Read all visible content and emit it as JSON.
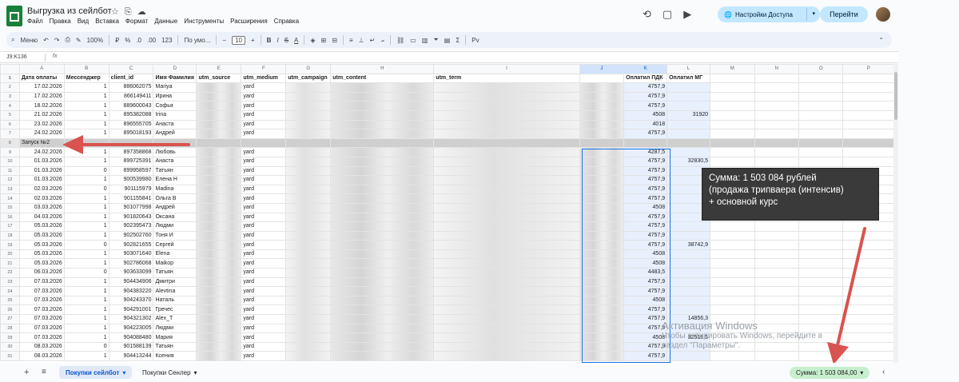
{
  "app": {
    "title": "Выгрузка из сейлбот",
    "menu": [
      "Файл",
      "Правка",
      "Вид",
      "Вставка",
      "Формат",
      "Данные",
      "Инструменты",
      "Расширения",
      "Справка"
    ],
    "access_button": "Настройки Доступа",
    "goto_button": "Перейти"
  },
  "toolbar": {
    "menus": "Меню",
    "zoom": "100%",
    "currency": "₽",
    "percent": "%",
    "decimals_down": ".0",
    "decimals_up": ".00",
    "number_format": "123",
    "font": "По умо...",
    "font_size": "10",
    "bold": "B",
    "italic": "I",
    "strike": "S",
    "text_color": "A"
  },
  "formula_bar": {
    "namebox": "J9:K136",
    "fx": "fx"
  },
  "columns": [
    "A",
    "B",
    "C",
    "D",
    "E",
    "F",
    "G",
    "H",
    "I",
    "J",
    "K",
    "L",
    "M",
    "N",
    "O",
    "P"
  ],
  "headers": [
    "Дата оплаты",
    "Мессенджер",
    "client_id",
    "Имя Фамилия",
    "utm_source",
    "utm_medium",
    "utm_campaign",
    "utm_content",
    "utm_term",
    "",
    "Оплатил ПДК",
    "Оплатил МГ"
  ],
  "rows": [
    {
      "n": "2",
      "a": "17.02.2026",
      "b": "1",
      "c": "886062075",
      "d": "Mariya",
      "f": "yard",
      "j": "4757,9",
      "k": ""
    },
    {
      "n": "3",
      "a": "17.02.2026",
      "b": "1",
      "c": "866149411",
      "d": "Ирина",
      "f": "yard",
      "j": "4757,9",
      "k": ""
    },
    {
      "n": "4",
      "a": "18.02.2026",
      "b": "1",
      "c": "889600043",
      "d": "Софья",
      "f": "yard",
      "j": "4757,9",
      "k": ""
    },
    {
      "n": "5",
      "a": "21.02.2026",
      "b": "1",
      "c": "895382088",
      "d": "Irina",
      "f": "yard",
      "j": "4508",
      "k": "31920"
    },
    {
      "n": "6",
      "a": "23.02.2026",
      "b": "1",
      "c": "896555705",
      "d": "Анаста",
      "f": "yard",
      "j": "4018",
      "k": ""
    },
    {
      "n": "7",
      "a": "24.02.2026",
      "b": "1",
      "c": "895018193",
      "d": "Андрей",
      "f": "yard",
      "j": "4757,9",
      "k": ""
    },
    {
      "n": "8",
      "launch": "Запуск №2"
    },
    {
      "n": "9",
      "a": "24.02.2026",
      "b": "1",
      "c": "897358868",
      "d": "Любовь",
      "f": "yard",
      "j": "4287,5",
      "k": ""
    },
    {
      "n": "10",
      "a": "01.03.2026",
      "b": "1",
      "c": "899725391",
      "d": "Анаста",
      "f": "yard",
      "j": "4757,9",
      "k": "32830,5"
    },
    {
      "n": "11",
      "a": "01.03.2026",
      "b": "0",
      "c": "899958597",
      "d": "Татьян",
      "f": "yard",
      "j": "4757,9",
      "k": ""
    },
    {
      "n": "12",
      "a": "01.03.2026",
      "b": "1",
      "c": "900539980",
      "d": "Елена Н",
      "f": "yard",
      "j": "4757,9",
      "k": ""
    },
    {
      "n": "13",
      "a": "02.03.2026",
      "b": "0",
      "c": "901115979",
      "d": "Madina",
      "f": "yard",
      "j": "4757,9",
      "k": ""
    },
    {
      "n": "14",
      "a": "02.03.2026",
      "b": "1",
      "c": "901155841",
      "d": "Ольга В",
      "f": "yard",
      "j": "4757,9",
      "k": ""
    },
    {
      "n": "15",
      "a": "03.03.2026",
      "b": "1",
      "c": "901077998",
      "d": "Андрей",
      "f": "yard",
      "j": "4508",
      "k": ""
    },
    {
      "n": "16",
      "a": "04.03.2026",
      "b": "1",
      "c": "901820643",
      "d": "Оксана",
      "f": "yard",
      "j": "4757,9",
      "k": ""
    },
    {
      "n": "17",
      "a": "05.03.2026",
      "b": "1",
      "c": "902395473",
      "d": "Людми",
      "f": "yard",
      "j": "4757,9",
      "k": ""
    },
    {
      "n": "18",
      "a": "05.03.2026",
      "b": "1",
      "c": "902502760",
      "d": "Тоня И",
      "f": "yard",
      "j": "4757,9",
      "k": ""
    },
    {
      "n": "19",
      "a": "05.03.2026",
      "b": "0",
      "c": "902821655",
      "d": "Сергей",
      "f": "yard",
      "j": "4757,9",
      "k": "38742,9"
    },
    {
      "n": "20",
      "a": "05.03.2026",
      "b": "1",
      "c": "903071640",
      "d": "Elena",
      "f": "yard",
      "j": "4508",
      "k": ""
    },
    {
      "n": "21",
      "a": "05.03.2026",
      "b": "1",
      "c": "902786068",
      "d": "Maikop",
      "f": "yard",
      "j": "4508",
      "k": ""
    },
    {
      "n": "22",
      "a": "06.03.2026",
      "b": "0",
      "c": "903633099",
      "d": "Татьян",
      "f": "yard",
      "j": "4483,5",
      "k": ""
    },
    {
      "n": "23",
      "a": "07.03.2026",
      "b": "1",
      "c": "904434906",
      "d": "Дмитри",
      "f": "yard",
      "j": "4757,9",
      "k": ""
    },
    {
      "n": "24",
      "a": "07.03.2026",
      "b": "1",
      "c": "904383220",
      "d": "Alevtina",
      "f": "yard",
      "j": "4757,9",
      "k": ""
    },
    {
      "n": "25",
      "a": "07.03.2026",
      "b": "1",
      "c": "904243370",
      "d": "Наталь",
      "f": "yard",
      "j": "4508",
      "k": ""
    },
    {
      "n": "26",
      "a": "07.03.2026",
      "b": "1",
      "c": "904291001",
      "d": "Гречес",
      "f": "yard",
      "j": "4757,9",
      "k": ""
    },
    {
      "n": "27",
      "a": "07.03.2026",
      "b": "1",
      "c": "904321302",
      "d": "Alex_T",
      "f": "yard",
      "j": "4757,9",
      "k": "14856,3"
    },
    {
      "n": "28",
      "a": "07.03.2026",
      "b": "1",
      "c": "904223005",
      "d": "Людми",
      "f": "yard",
      "j": "4757,9",
      "k": ""
    },
    {
      "n": "29",
      "a": "07.03.2026",
      "b": "1",
      "c": "904088480",
      "d": "Мария",
      "f": "yard",
      "j": "4508",
      "k": "32518,5"
    },
    {
      "n": "30",
      "a": "08.03.2026",
      "b": "0",
      "c": "901588139",
      "d": "Татьян",
      "f": "yard",
      "j": "4757,9",
      "k": ""
    },
    {
      "n": "31",
      "a": "08.03.2026",
      "b": "1",
      "c": "904413244",
      "d": "Ксения",
      "f": "yard",
      "j": "4757,9",
      "k": ""
    }
  ],
  "annotation": {
    "line1": "Сумма: 1 503 084 рублей",
    "line2": "(продажа трипваера (интенсив)",
    "line3": "+ основной курс"
  },
  "watermark": {
    "title": "Активация Windows",
    "line1": "Чтобы активировать Windows, перейдите в",
    "line2": "раздел \"Параметры\"."
  },
  "sheets": {
    "active": "Покупки сейлбот",
    "other": "Покупки Сенлер"
  },
  "status": {
    "sum": "Сумма: 1 503 084,00"
  },
  "colors": {
    "accent": "#0b57d0",
    "arrow": "#d9534f",
    "selection": "#e8f0fe",
    "sum_chip": "#c6efce"
  }
}
